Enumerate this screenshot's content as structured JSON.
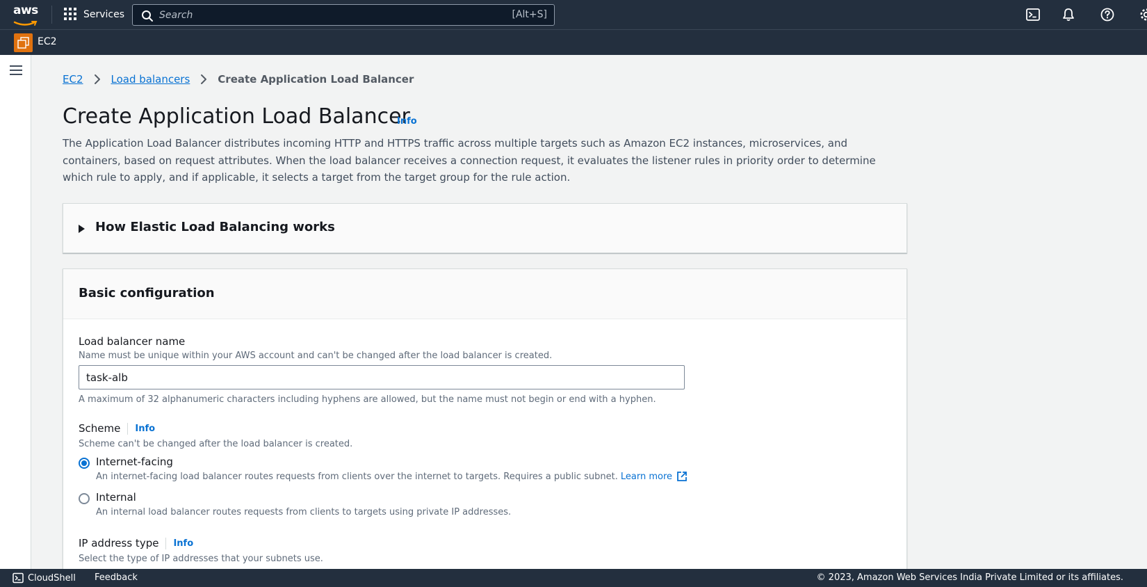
{
  "topnav": {
    "logo_text": "aws",
    "services_label": "Services",
    "search_placeholder": "Search",
    "search_shortcut": "[Alt+S]"
  },
  "subnav": {
    "service_name": "EC2"
  },
  "breadcrumb": {
    "items": [
      "EC2",
      "Load balancers"
    ],
    "current": "Create Application Load Balancer"
  },
  "page": {
    "title": "Create Application Load Balancer",
    "info_label": "Info",
    "description": "The Application Load Balancer distributes incoming HTTP and HTTPS traffic across multiple targets such as Amazon EC2 instances, microservices, and containers, based on request attributes. When the load balancer receives a connection request, it evaluates the listener rules in priority order to determine which rule to apply, and if applicable, it selects a target from the target group for the rule action."
  },
  "elb_panel": {
    "title": "How Elastic Load Balancing works"
  },
  "basic_config": {
    "title": "Basic configuration",
    "name_label": "Load balancer name",
    "name_desc": "Name must be unique within your AWS account and can't be changed after the load balancer is created.",
    "name_value": "task-alb",
    "name_constraint": "A maximum of 32 alphanumeric characters including hyphens are allowed, but the name must not begin or end with a hyphen.",
    "scheme_label": "Scheme",
    "scheme_info": "Info",
    "scheme_desc": "Scheme can't be changed after the load balancer is created.",
    "internet_facing_label": "Internet-facing",
    "internet_facing_desc": "An internet-facing load balancer routes requests from clients over the internet to targets. Requires a public subnet.",
    "learn_more": "Learn more",
    "internal_label": "Internal",
    "internal_desc": "An internal load balancer routes requests from clients to targets using private IP addresses.",
    "ip_type_label": "IP address type",
    "ip_type_info": "Info",
    "ip_type_desc": "Select the type of IP addresses that your subnets use."
  },
  "footer": {
    "cloudshell": "CloudShell",
    "feedback": "Feedback",
    "copyright": "© 2023, Amazon Web Services India Private Limited or its affiliates."
  },
  "colors": {
    "nav_bg": "#232f3e",
    "link": "#0972d3",
    "ec2_orange": "#e0720f",
    "page_bg": "#f2f3f3"
  }
}
